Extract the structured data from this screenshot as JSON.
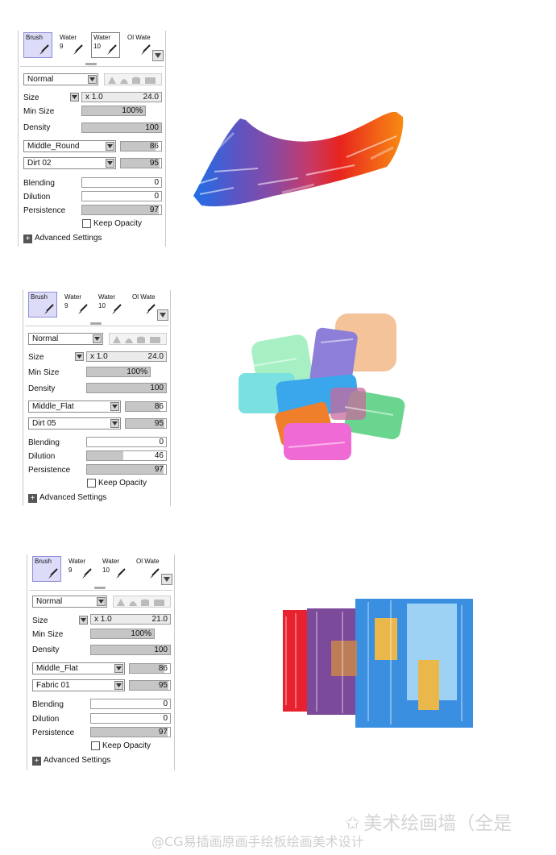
{
  "panels": [
    {
      "tools": [
        {
          "name": "Brush",
          "num": ""
        },
        {
          "name": "Water",
          "num": "9"
        },
        {
          "name": "Water",
          "num": "10"
        },
        {
          "name": "Ol Wate",
          "num": ""
        }
      ],
      "blend_mode": "Normal",
      "size_label": "Size",
      "size_multiplier": "x 1.0",
      "size_value": "24.0",
      "minsize_label": "Min Size",
      "minsize_value": "100%",
      "minsize_level": 1.0,
      "density_label": "Density",
      "density_value": "100",
      "density_level": 1.0,
      "shape": "Middle_Round",
      "shape_value": "86",
      "shape_level": 0.86,
      "texture": "Dirt 02",
      "texture_value": "95",
      "texture_level": 0.95,
      "blending_label": "Blending",
      "blending_value": "0",
      "blending_level": 0.0,
      "dilution_label": "Dilution",
      "dilution_value": "0",
      "dilution_level": 0.0,
      "persistence_label": "Persistence",
      "persistence_value": "97",
      "persistence_level": 0.97,
      "keep_opacity_label": "Keep Opacity",
      "advanced_label": "Advanced Settings"
    },
    {
      "tools": [
        {
          "name": "Brush",
          "num": ""
        },
        {
          "name": "Water",
          "num": "9"
        },
        {
          "name": "Water",
          "num": "10"
        },
        {
          "name": "Ol Wate",
          "num": ""
        }
      ],
      "blend_mode": "Normal",
      "size_label": "Size",
      "size_multiplier": "x 1.0",
      "size_value": "24.0",
      "minsize_label": "Min Size",
      "minsize_value": "100%",
      "minsize_level": 1.0,
      "density_label": "Density",
      "density_value": "100",
      "density_level": 1.0,
      "shape": "Middle_Flat",
      "shape_value": "86",
      "shape_level": 0.86,
      "texture": "Dirt 05",
      "texture_value": "95",
      "texture_level": 0.95,
      "blending_label": "Blending",
      "blending_value": "0",
      "blending_level": 0.0,
      "dilution_label": "Dilution",
      "dilution_value": "46",
      "dilution_level": 0.46,
      "persistence_label": "Persistence",
      "persistence_value": "97",
      "persistence_level": 0.97,
      "keep_opacity_label": "Keep Opacity",
      "advanced_label": "Advanced Settings"
    },
    {
      "tools": [
        {
          "name": "Brush",
          "num": ""
        },
        {
          "name": "Water",
          "num": "9"
        },
        {
          "name": "Water",
          "num": "10"
        },
        {
          "name": "Ol Wate",
          "num": ""
        }
      ],
      "blend_mode": "Normal",
      "size_label": "Size",
      "size_multiplier": "x 1.0",
      "size_value": "21.0",
      "minsize_label": "Min Size",
      "minsize_value": "100%",
      "minsize_level": 1.0,
      "density_label": "Density",
      "density_value": "100",
      "density_level": 1.0,
      "shape": "Middle_Flat",
      "shape_value": "86",
      "shape_level": 0.86,
      "texture": "Fabric 01",
      "texture_value": "95",
      "texture_level": 0.95,
      "blending_label": "Blending",
      "blending_value": "0",
      "blending_level": 0.0,
      "dilution_label": "Dilution",
      "dilution_value": "0",
      "dilution_level": 0.0,
      "persistence_label": "Persistence",
      "persistence_value": "97",
      "persistence_level": 0.97,
      "keep_opacity_label": "Keep Opacity",
      "advanced_label": "Advanced Settings"
    }
  ],
  "watermark": {
    "main": "美术绘画墙（全是",
    "handle": "@CG易插画原画手绘板绘画美术设计"
  },
  "colors": {
    "selected_tool_bg": "#dcdcf8",
    "slider_fill": "#c6c6c6",
    "stroke1": [
      "#1f6fe8",
      "#5a55c4",
      "#8a4aa2",
      "#c53a6a",
      "#e8241e",
      "#f05a18",
      "#f98a12"
    ],
    "stroke2": [
      "#a6f0c4",
      "#f4c39a",
      "#8d7fd8",
      "#3aa6ec",
      "#f07f2c",
      "#f06ad6",
      "#6ad58f",
      "#7ae0e0"
    ],
    "stroke3": [
      "#e8212e",
      "#7b4a9a",
      "#3b8fe0",
      "#9ed2f5",
      "#e9b74a"
    ]
  }
}
